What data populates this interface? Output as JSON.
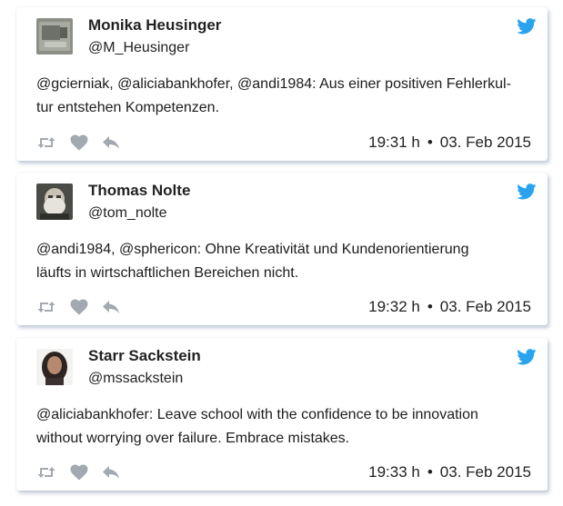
{
  "colors": {
    "twitter_blue": "#2aa3ef",
    "action_gray": "#a3a9b0"
  },
  "tweets": [
    {
      "name": "Monika Heusinger",
      "handle": "@M_Heusinger",
      "text_line1": "@gcierniak, @aliciabankhofer, @andi1984: Aus einer positiven Fehlerkul-",
      "text_line2": "tur entstehen Kompetenzen.",
      "time": "19:31 h",
      "date": "03. Feb 2015"
    },
    {
      "name": "Thomas Nolte",
      "handle": "@tom_nolte",
      "text_line1": "@andi1984, @sphericon: Ohne Kreativität und Kundenorientierung",
      "text_line2": "läufts in wirtschaftlichen Bereichen nicht.",
      "time": "19:32 h",
      "date": "03. Feb 2015"
    },
    {
      "name": "Starr Sackstein",
      "handle": "@mssackstein",
      "text_line1": "@aliciabankhofer: Leave school with the confidence to be innovation",
      "text_line2": "without worrying over failure. Embrace mistakes.",
      "time": "19:33 h",
      "date": "03. Feb 2015"
    }
  ],
  "separator": "•",
  "icons": [
    "twitter-bird-icon",
    "retweet-icon",
    "heart-icon",
    "reply-icon"
  ]
}
